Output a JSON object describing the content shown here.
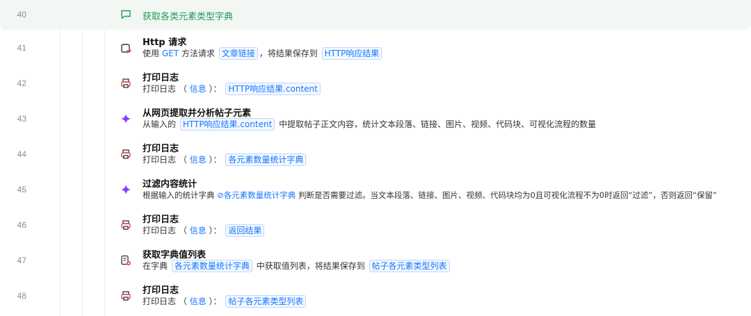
{
  "steps": [
    {
      "line": "40",
      "title": "获取各类元素类型字典",
      "icon": "chat-bubble-icon"
    },
    {
      "line": "41",
      "title": "Http 请求",
      "icon": "http-request-icon",
      "d": [
        "使用",
        "GET",
        "方法请求",
        "文章链接",
        "，将结果保存到",
        "HTTP响应结果"
      ]
    },
    {
      "line": "42",
      "title": "打印日志",
      "icon": "printer-icon",
      "d": [
        "打印日志",
        "（",
        "信息",
        "）：",
        "HTTP响应结果.content"
      ]
    },
    {
      "line": "43",
      "title": "从网页提取并分析帖子元素",
      "icon": "sparkle-icon",
      "d": [
        "从输入的",
        "HTTP响应结果.content",
        "中提取帖子正文内容，统计文本段落、链接、图片、视频、代码块、可视化流程的数量"
      ]
    },
    {
      "line": "44",
      "title": "打印日志",
      "icon": "printer-icon",
      "d": [
        "打印日志",
        "（",
        "信息",
        "）：",
        "各元素数量统计字典"
      ]
    },
    {
      "line": "45",
      "title": "过滤内容统计",
      "icon": "sparkle-icon",
      "d": [
        "根据输入的统计字典",
        "各元素数量统计字典",
        "判断是否需要过滤。当文本段落、链接、图片、视频、代码块均为0且可视化流程不为0时返回“过滤”，否则返回“保留”"
      ]
    },
    {
      "line": "46",
      "title": "打印日志",
      "icon": "printer-icon",
      "d": [
        "打印日志",
        "（",
        "信息",
        "）：",
        "返回结果"
      ]
    },
    {
      "line": "47",
      "title": "获取字典值列表",
      "icon": "dict-values-icon",
      "d": [
        "在字典",
        "各元素数量统计字典",
        "中获取值列表，将结果保存到",
        "帖子各元素类型列表"
      ]
    },
    {
      "line": "48",
      "title": "打印日志",
      "icon": "printer-icon",
      "d": [
        "打印日志",
        "（",
        "信息",
        "）：",
        "帖子各元素类型列表"
      ]
    }
  ],
  "colors": {
    "accent": "#1677ff",
    "green": "#1f9a5b",
    "purple": "#8a3ffc",
    "red": "#e5484d"
  }
}
